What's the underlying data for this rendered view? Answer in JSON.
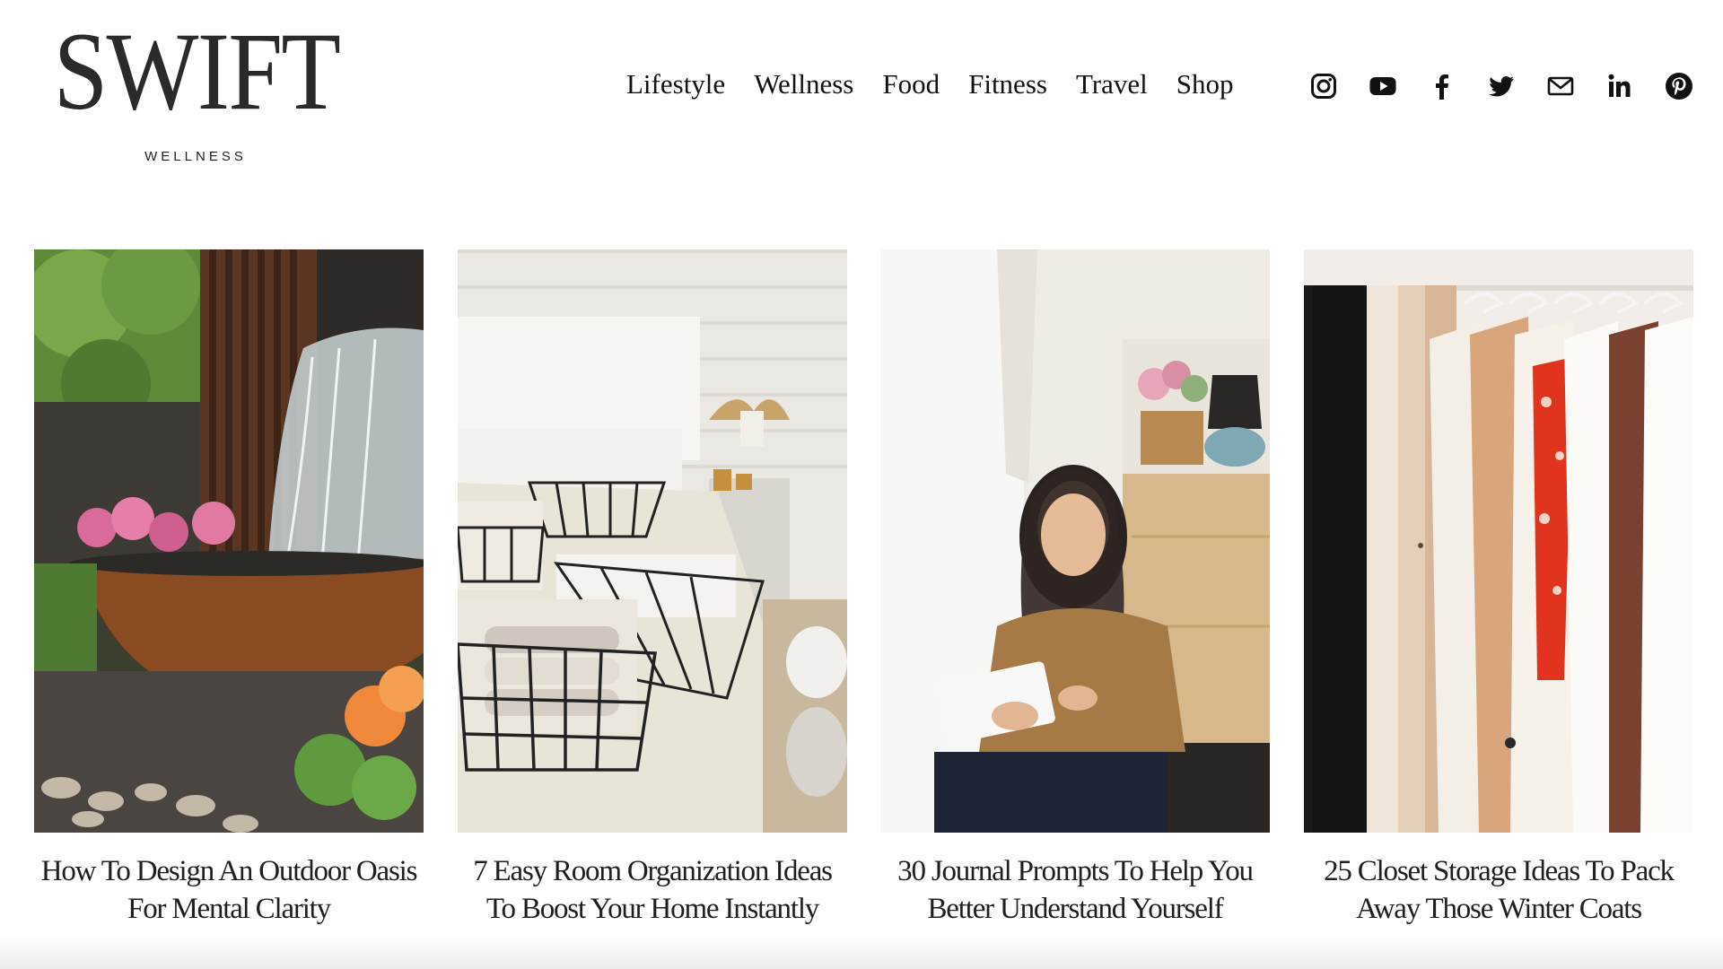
{
  "brand": {
    "name": "SWIFT",
    "tagline": "WELLNESS"
  },
  "nav": {
    "items": [
      "Lifestyle",
      "Wellness",
      "Food",
      "Fitness",
      "Travel",
      "Shop"
    ]
  },
  "social": {
    "icons": [
      "instagram-icon",
      "youtube-icon",
      "facebook-icon",
      "twitter-icon",
      "email-icon",
      "linkedin-icon",
      "pinterest-icon"
    ]
  },
  "articles": [
    {
      "title_line1": "How To Design An Outdoor Oasis",
      "title_line2": "For Mental Clarity",
      "image": "outdoor-water-feature-photo"
    },
    {
      "title_line1": "7 Easy Room Organization Ideas",
      "title_line2": "To Boost Your Home Instantly",
      "image": "bedroom-wire-baskets-photo"
    },
    {
      "title_line1": "30 Journal Prompts To Help You",
      "title_line2": "Better Understand Yourself",
      "image": "woman-journaling-photo"
    },
    {
      "title_line1": "25 Closet Storage Ideas To Pack",
      "title_line2": "Away Those Winter Coats",
      "image": "clothing-rack-photo"
    }
  ],
  "colors": {
    "text": "#1a1a1a",
    "background": "#ffffff"
  }
}
